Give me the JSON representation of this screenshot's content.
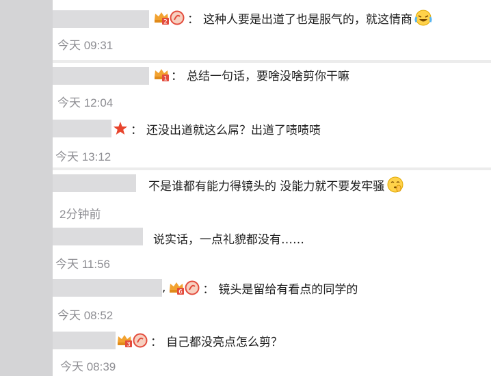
{
  "comments": [
    {
      "text": "这种人要是出道了也是服气的，就这情商",
      "time": "今天 09:31",
      "badges": [
        "crown-2",
        "avatar"
      ],
      "emoji": "cry-laugh-emoji"
    },
    {
      "text": "总结一句话，要啥没啥剪你干嘛",
      "time": "今天 12:04",
      "badges": [
        "crown-1"
      ]
    },
    {
      "text": "还没出道就这么屌？出道了啧啧啧",
      "time": "今天 13:12",
      "badges": [
        "star"
      ]
    },
    {
      "text": "不是谁都有能力得镜头的 没能力就不要发牢骚",
      "time": "2分钟前",
      "badges": [],
      "emoji": "shush-emoji"
    },
    {
      "text": "说实话，一点礼貌都没有……",
      "time": "今天 11:56",
      "badges": []
    },
    {
      "text": "镜头是留给有看点的同学的",
      "time": "今天 08:52",
      "badges": [
        "crown-6",
        "avatar"
      ],
      "comma": ","
    },
    {
      "text": "自己都没亮点怎么剪？",
      "time": "今天 08:39",
      "badges": [
        "crown-3",
        "avatar"
      ]
    }
  ],
  "separator": "：",
  "comma": ",",
  "crown_levels": {
    "c1": "1",
    "c2": "2",
    "c3": "3",
    "c6": "6"
  },
  "colors": {
    "crown": "#f2a230",
    "badge": "#e34b3c",
    "star": "#e8452d",
    "timestamp": "#8e8e93"
  }
}
